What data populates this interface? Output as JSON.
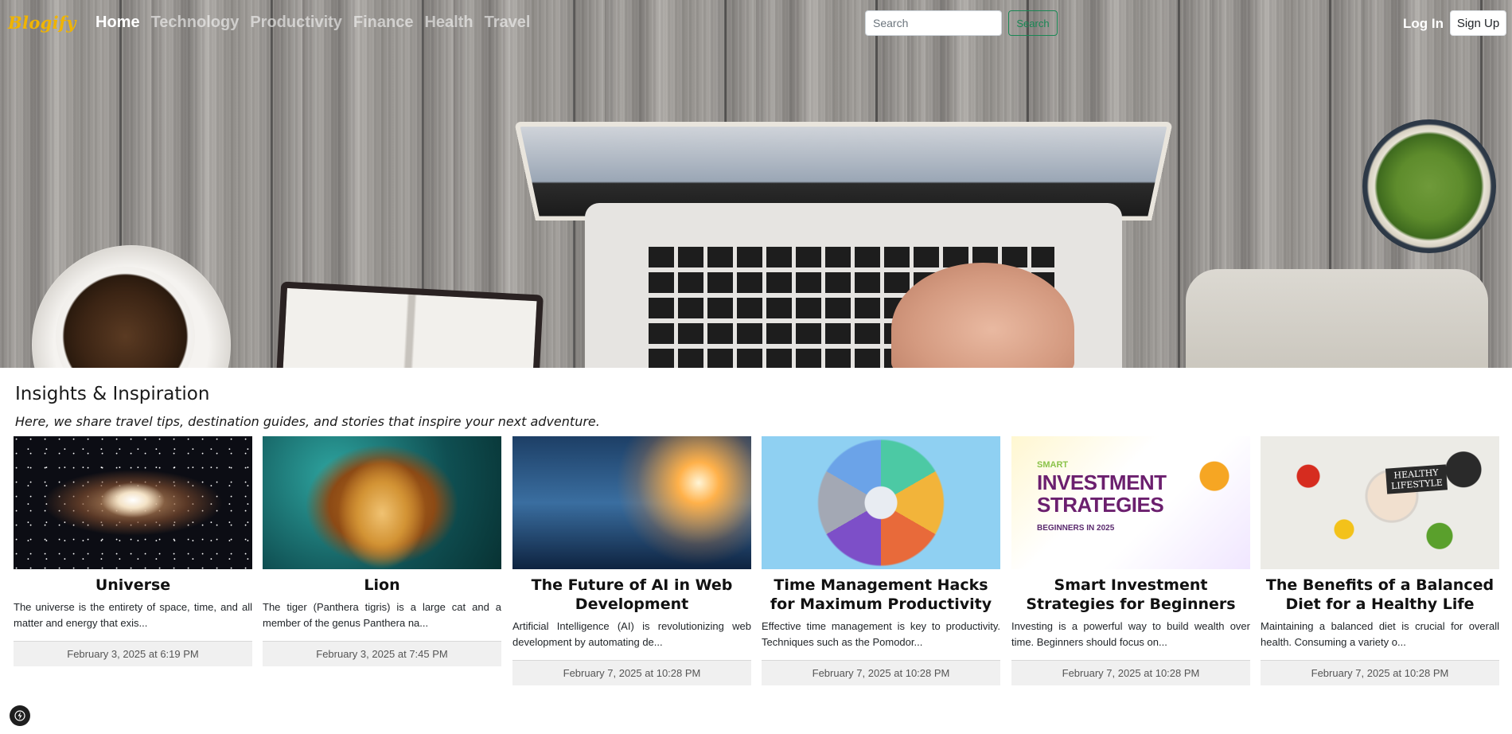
{
  "brand": "Blogify",
  "nav": {
    "links": [
      "Home",
      "Technology",
      "Productivity",
      "Finance",
      "Health",
      "Travel"
    ]
  },
  "search": {
    "placeholder": "Search",
    "button_label": "Search"
  },
  "auth": {
    "login_label": "Log In",
    "signup_label": "Sign Up"
  },
  "section": {
    "title": "Insights & Inspiration",
    "subtitle": "Here, we share travel tips, destination guides, and stories that inspire your next adventure."
  },
  "cards": [
    {
      "title": "Universe",
      "excerpt": "The universe is the entirety of space, time, and all matter and energy that exis...",
      "date": "February 3, 2025 at 6:19 PM"
    },
    {
      "title": "Lion",
      "excerpt": "The tiger (Panthera tigris) is a large cat and a member of the genus Panthera na...",
      "date": "February 3, 2025 at 7:45 PM"
    },
    {
      "title": "The Future of AI in Web Development",
      "excerpt": "Artificial Intelligence (AI) is revolutionizing web development by automating de...",
      "date": "February 7, 2025 at 10:28 PM"
    },
    {
      "title": "Time Management Hacks for Maximum Productivity",
      "excerpt": "Effective time management is key to productivity. Techniques such as the Pomodor...",
      "date": "February 7, 2025 at 10:28 PM"
    },
    {
      "title": "Smart Investment Strategies for Beginners",
      "excerpt": "Investing is a powerful way to build wealth over time. Beginners should focus on...",
      "date": "February 7, 2025 at 10:28 PM"
    },
    {
      "title": "The Benefits of a Balanced Diet for a Healthy Life",
      "excerpt": "Maintaining a balanced diet is crucial for overall health. Consuming a variety o...",
      "date": "February 7, 2025 at 10:28 PM"
    }
  ],
  "card_images": {
    "invest_smart": "SMART",
    "invest_title": "INVESTMENT STRATEGIES",
    "invest_sub": "BEGINNERS IN 2025",
    "diet_label": "HEALTHY LIFESTYLE"
  },
  "colors": {
    "brand": "#f0b400",
    "search_button": "#198754"
  },
  "icons": {
    "corner": "lightning-bolt-icon"
  }
}
